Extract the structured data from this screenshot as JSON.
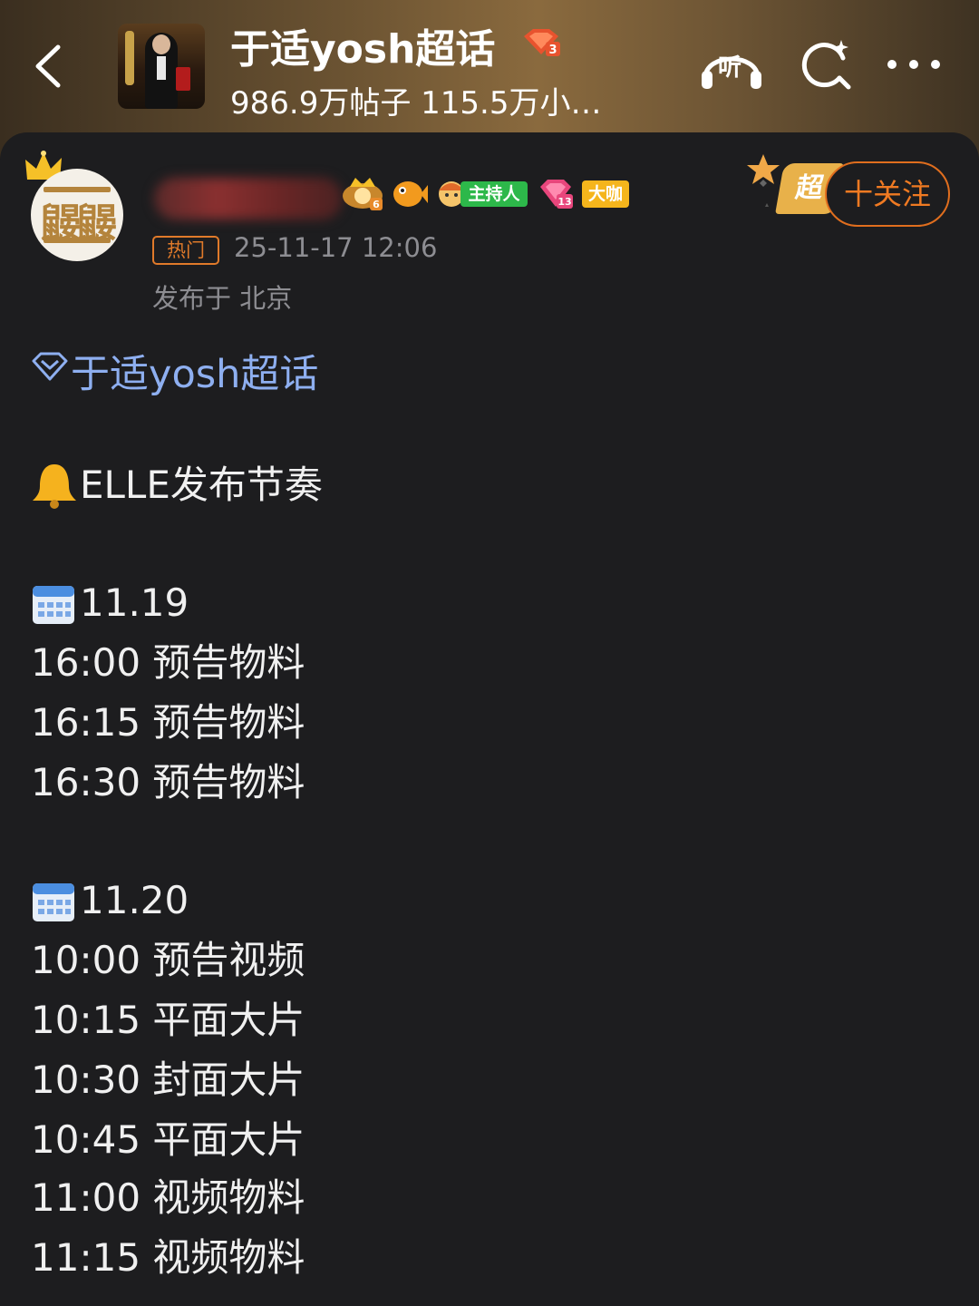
{
  "header": {
    "back_icon": "chevron-left-icon",
    "topic_title": "于适yosh超话",
    "level_badge_icon": "diamond-level-3-icon",
    "stats_text": "986.9万帖子 115.5万小…",
    "listen_label": "听",
    "listen_icon": "headphones-icon",
    "search_icon": "search-icon",
    "more_icon": "more-dots-icon"
  },
  "post": {
    "username_blurred": true,
    "badges": [
      {
        "icon": "level-6-crown-badge-icon"
      },
      {
        "icon": "fish-badge-icon"
      },
      {
        "icon": "host-badge-icon",
        "label": "主持人"
      },
      {
        "icon": "diamond-level-13-badge-icon"
      },
      {
        "icon": "daka-badge-icon",
        "label": "大咖"
      }
    ],
    "hot_tag": "热门",
    "time": "25-11-17 12:06",
    "location": "发布于 北京",
    "super_badge_label": "超",
    "follow_label": "十关注",
    "topic_link": "于适yosh超话",
    "headline": "ELLE发布节奏",
    "days": [
      {
        "date": "11.19",
        "items": [
          "16:00 预告物料",
          "16:15 预告物料",
          "16:30 预告物料"
        ]
      },
      {
        "date": "11.20",
        "items": [
          "10:00 预告视频",
          "10:15 平面大片",
          "10:30 封面大片",
          "10:45 平面大片",
          "11:00 视频物料",
          "11:15 视频物料"
        ]
      }
    ]
  },
  "colors": {
    "background": "#1d1d1f",
    "accent_orange": "#f07a22",
    "topic_link": "#8eaff0",
    "meta_grey": "#8d8d92",
    "host_green": "#2db84a",
    "daka_yellow": "#f5b51c"
  }
}
